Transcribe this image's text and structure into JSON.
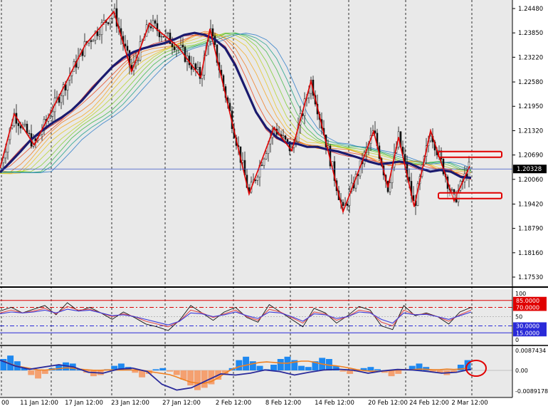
{
  "chart_data": [
    {
      "type": "candlestick",
      "panel": "price",
      "y_ticks": [
        "1.24480",
        "1.23850",
        "1.23220",
        "1.22580",
        "1.21950",
        "1.21320",
        "1.20690",
        "1.20060",
        "1.19420",
        "1.18790",
        "1.18160",
        "1.17530"
      ],
      "ylim": [
        1.1715,
        1.2485
      ],
      "current_price_label": "1.20328",
      "current_price": 1.20328,
      "x_ticks": [
        "00",
        "11 Jan 12:00",
        "17 Jan 12:00",
        "23 Jan 12:00",
        "27 Jan 12:00",
        "2 Feb 12:00",
        "8 Feb 12:00",
        "14 Feb 12:00",
        "20 Feb 12:00",
        "24 Feb 12:00",
        "2 Mar 12:00"
      ],
      "grid": true,
      "colors": {
        "background": "#e9e9e9",
        "grid": "#000000",
        "ema_slow": "#1a1a6e",
        "zigzag": "#e00000",
        "current_price_line": "#3a55c8"
      },
      "ema_slow": [
        1.2024,
        1.205,
        1.2078,
        1.2108,
        1.213,
        1.215,
        1.2166,
        1.2185,
        1.221,
        1.224,
        1.227,
        1.2298,
        1.232,
        1.2335,
        1.2345,
        1.2352,
        1.2358,
        1.2368,
        1.238,
        1.2385,
        1.238,
        1.2368,
        1.2345,
        1.23,
        1.224,
        1.218,
        1.214,
        1.2115,
        1.21,
        1.2098,
        1.209,
        1.209,
        1.2083,
        1.2078,
        1.207,
        1.2062,
        1.2052,
        1.2045,
        1.2048,
        1.2052,
        1.2047,
        1.2035,
        1.2026,
        1.203,
        1.2026,
        1.2012,
        1.201
      ],
      "zigzag": [
        1.2035,
        1.2175,
        1.2095,
        1.2355,
        1.244,
        1.2285,
        1.241,
        1.235,
        1.227,
        1.2395,
        1.1968,
        1.214,
        1.208,
        1.226,
        1.1922,
        1.213,
        1.1985,
        1.2115,
        1.1935,
        1.2132,
        1.195,
        1.204
      ],
      "zones": [
        {
          "name": "resistance",
          "from": 1.2065,
          "to": 1.2078
        },
        {
          "name": "support",
          "from": 1.1958,
          "to": 1.1971
        }
      ]
    },
    {
      "type": "line",
      "panel": "oscillator",
      "levels": [
        {
          "label": "85.0000",
          "value": 85,
          "color": "#e00000",
          "line": "solid"
        },
        {
          "label": "70.0000",
          "value": 70,
          "color": "#e00000",
          "line": "dashed"
        },
        {
          "label": "30.0000",
          "value": 30,
          "color": "#2a2ad8",
          "line": "dashed"
        },
        {
          "label": "15.0000",
          "value": 15,
          "color": "#2a2ad8",
          "line": "solid"
        }
      ],
      "axis_labels": [
        "100",
        "50",
        "0"
      ],
      "ylim": [
        0,
        100
      ],
      "series": [
        {
          "color": "#111111",
          "values": [
            62,
            70,
            58,
            66,
            74,
            54,
            80,
            62,
            70,
            58,
            44,
            60,
            48,
            34,
            28,
            20,
            42,
            74,
            58,
            42,
            60,
            70,
            48,
            38,
            76,
            60,
            44,
            28,
            68,
            58,
            36,
            52,
            72,
            64,
            30,
            22,
            74,
            52,
            58,
            50,
            34,
            60,
            70
          ]
        },
        {
          "color": "#e05050",
          "values": [
            58,
            64,
            58,
            62,
            68,
            56,
            72,
            64,
            66,
            58,
            50,
            56,
            50,
            40,
            34,
            28,
            40,
            64,
            58,
            48,
            56,
            64,
            50,
            42,
            66,
            60,
            48,
            36,
            60,
            56,
            42,
            50,
            64,
            60,
            38,
            30,
            64,
            54,
            56,
            50,
            40,
            54,
            64
          ]
        },
        {
          "color": "#3a3adb",
          "values": [
            56,
            60,
            58,
            60,
            64,
            58,
            66,
            62,
            64,
            58,
            52,
            54,
            50,
            44,
            38,
            32,
            40,
            58,
            56,
            50,
            54,
            60,
            52,
            46,
            60,
            58,
            50,
            40,
            56,
            54,
            46,
            50,
            60,
            58,
            44,
            36,
            58,
            54,
            55,
            50,
            44,
            52,
            60
          ]
        }
      ]
    },
    {
      "type": "bar",
      "panel": "macd",
      "axis_labels": [
        "0.0087434",
        "0.00",
        "-0.0089178"
      ],
      "ylim": [
        -0.0089178,
        0.0087434
      ],
      "histogram": [
        0.005,
        0.0065,
        0.004,
        0.001,
        -0.002,
        -0.0035,
        -0.0015,
        0.001,
        0.0025,
        0.0035,
        0.003,
        0.0005,
        -0.001,
        -0.0025,
        -0.002,
        0.0005,
        0.002,
        0.003,
        0.0015,
        -0.001,
        -0.003,
        -0.0015,
        0.0005,
        0.001,
        -0.0005,
        -0.002,
        -0.004,
        -0.0065,
        -0.0085,
        -0.0075,
        -0.006,
        -0.004,
        -0.002,
        0.001,
        0.0045,
        0.006,
        0.004,
        0.002,
        0.0005,
        0.0025,
        0.005,
        0.006,
        0.0045,
        0.002,
        0.0015,
        0.004,
        0.0055,
        0.005,
        0.002,
        -0.0005,
        -0.0015,
        -0.0005,
        0.001,
        0.0015,
        0.0005,
        -0.001,
        -0.0025,
        -0.0015,
        0.0005,
        0.002,
        0.003,
        0.0015,
        -0.0005,
        -0.001,
        -0.002,
        -0.001,
        0.0025,
        0.0045
      ],
      "signal": [
        0.0045,
        0.002,
        0.0005,
        0.0015,
        0.0025,
        0.0015,
        -0.0008,
        -0.0012,
        0.0005,
        0.001,
        -0.0005,
        -0.006,
        -0.0085,
        -0.0075,
        -0.0045,
        -0.0015,
        -0.002,
        -0.0012,
        0.0002,
        -0.0005,
        -0.002,
        -0.0008,
        0.0002,
        0.0005,
        0.0001,
        -0.0012,
        -0.0002,
        0.0004,
        0.0002,
        -0.0004,
        -0.0012,
        -0.0008,
        0.0005
      ],
      "colors": {
        "positive": "#1e88f0",
        "negative": "#f4a070",
        "main": "#f08020",
        "signal": "#2a2a9a"
      },
      "annotation": "red circle at latest bar"
    }
  ]
}
